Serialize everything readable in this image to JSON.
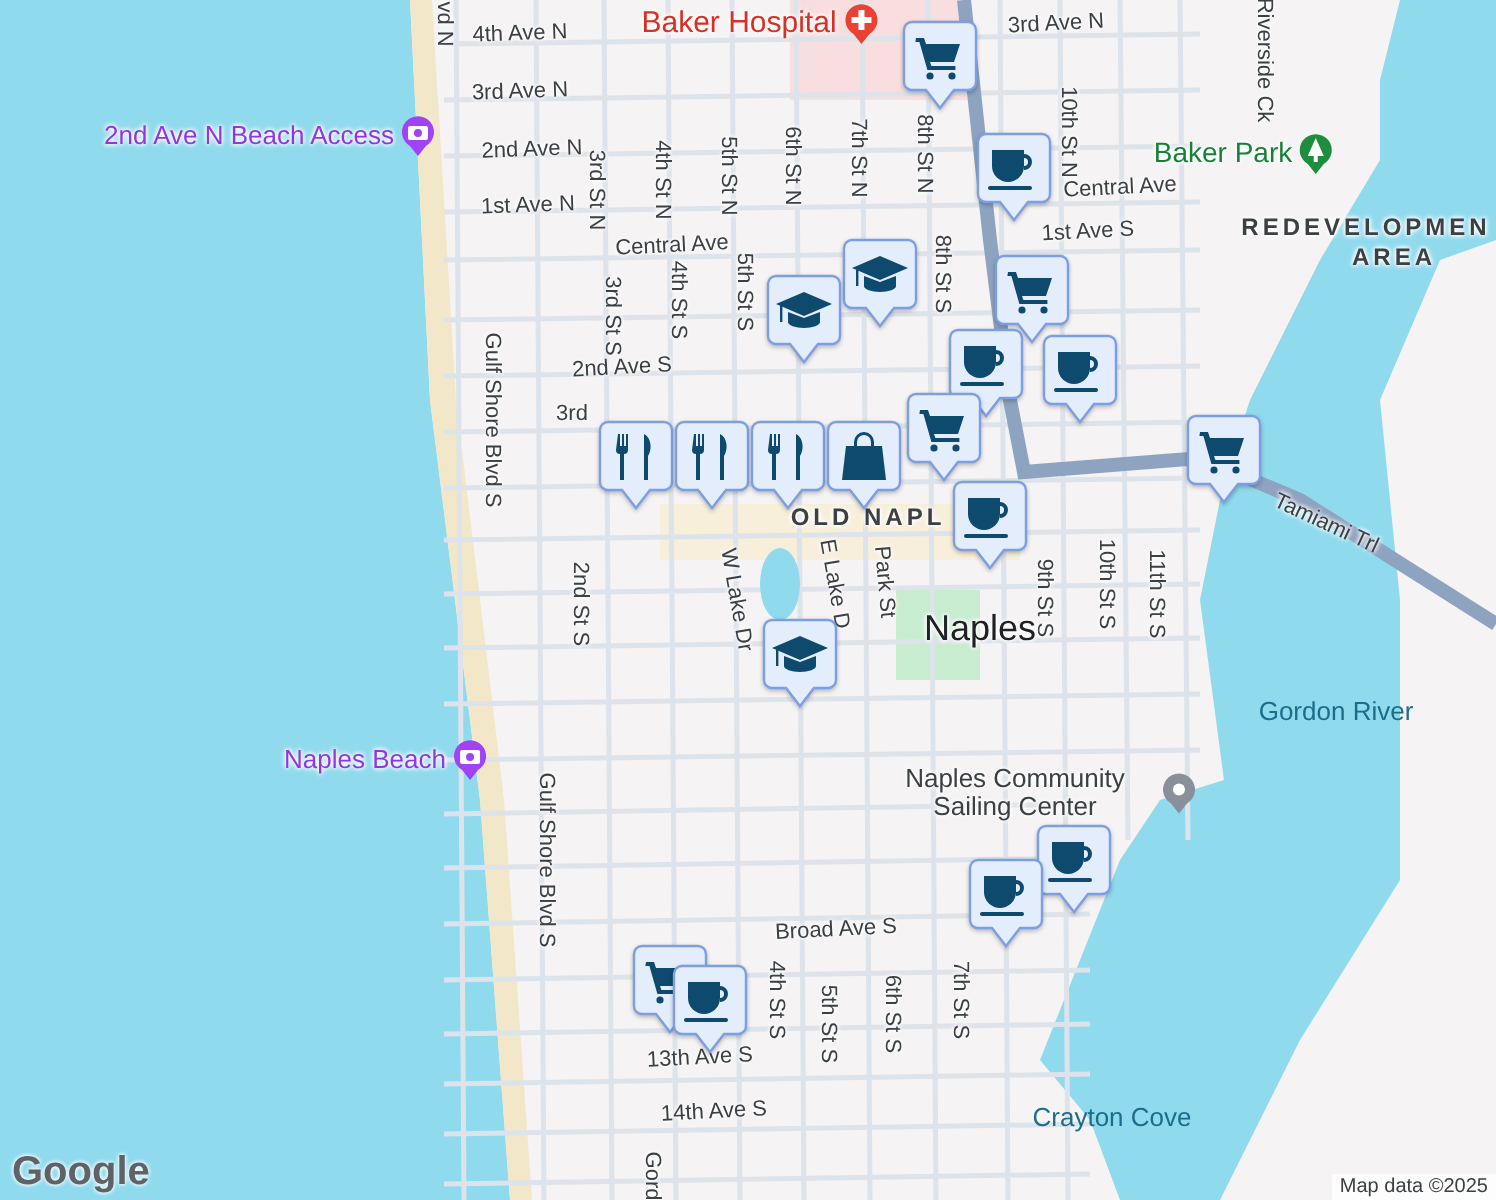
{
  "map": {
    "labels": [
      {
        "text": "vd N",
        "kind": "street"
      },
      {
        "text": "4th Ave N",
        "kind": "street"
      },
      {
        "text": "3rd Ave N",
        "kind": "street"
      },
      {
        "text": "2nd Ave N",
        "kind": "street"
      },
      {
        "text": "1st Ave N",
        "kind": "street"
      },
      {
        "text": "3rd St N",
        "kind": "street"
      },
      {
        "text": "4th St N",
        "kind": "street"
      },
      {
        "text": "5th St N",
        "kind": "street"
      },
      {
        "text": "6th St N",
        "kind": "street"
      },
      {
        "text": "7th St N",
        "kind": "street"
      },
      {
        "text": "8th St N",
        "kind": "street"
      },
      {
        "text": "10th St N",
        "kind": "street"
      },
      {
        "text": "3rd Ave N",
        "kind": "street"
      },
      {
        "text": "Central Ave",
        "kind": "street"
      },
      {
        "text": "Central Ave",
        "kind": "street"
      },
      {
        "text": "1st Ave S",
        "kind": "street"
      },
      {
        "text": "3rd St S",
        "kind": "street"
      },
      {
        "text": "4th St S",
        "kind": "street"
      },
      {
        "text": "5th St S",
        "kind": "street"
      },
      {
        "text": "8th St S",
        "kind": "street"
      },
      {
        "text": "2nd Ave S",
        "kind": "street"
      },
      {
        "text": "Riverside Ck",
        "kind": "street"
      },
      {
        "text": "Gulf Shore Blvd S",
        "kind": "street"
      },
      {
        "text": "3rd",
        "kind": "street"
      },
      {
        "text": "2nd St S",
        "kind": "street"
      },
      {
        "text": "W Lake Dr",
        "kind": "street"
      },
      {
        "text": "E Lake D",
        "kind": "street"
      },
      {
        "text": "Park St",
        "kind": "street"
      },
      {
        "text": "9th St S",
        "kind": "street"
      },
      {
        "text": "10th St S",
        "kind": "street"
      },
      {
        "text": "11th St S",
        "kind": "street"
      },
      {
        "text": "Tamiami Trl",
        "kind": "street"
      },
      {
        "text": "Gulf Shore Blvd S",
        "kind": "street"
      },
      {
        "text": "Broad Ave S",
        "kind": "street"
      },
      {
        "text": "4th St S",
        "kind": "street"
      },
      {
        "text": "5th St S",
        "kind": "street"
      },
      {
        "text": "6th St S",
        "kind": "street"
      },
      {
        "text": "7th St S",
        "kind": "street"
      },
      {
        "text": "13th Ave S",
        "kind": "street"
      },
      {
        "text": "14th Ave S",
        "kind": "street"
      },
      {
        "text": "Gord",
        "kind": "street"
      },
      {
        "text": "Baker Hospital",
        "kind": "hospital"
      },
      {
        "text": "2nd Ave N Beach Access",
        "kind": "beach"
      },
      {
        "text": "Naples Beach",
        "kind": "beach"
      },
      {
        "text": "Baker Park",
        "kind": "park"
      },
      {
        "text": "REDEVELOPMEN",
        "kind": "district"
      },
      {
        "text": "AREA",
        "kind": "district"
      },
      {
        "text": "OLD NAPL",
        "kind": "district"
      },
      {
        "text": "Naples",
        "kind": "city"
      },
      {
        "text": "Gordon River",
        "kind": "water"
      },
      {
        "text": "Naples Community Sailing Center",
        "kind": "marina"
      },
      {
        "text": "Crayton Cove",
        "kind": "water"
      }
    ],
    "markers": [
      {
        "kind": "cart"
      },
      {
        "kind": "cup"
      },
      {
        "kind": "cap"
      },
      {
        "kind": "cap"
      },
      {
        "kind": "cart"
      },
      {
        "kind": "cup"
      },
      {
        "kind": "cup"
      },
      {
        "kind": "fork"
      },
      {
        "kind": "fork"
      },
      {
        "kind": "fork"
      },
      {
        "kind": "bag"
      },
      {
        "kind": "cart"
      },
      {
        "kind": "cup"
      },
      {
        "kind": "cart"
      },
      {
        "kind": "cap"
      },
      {
        "kind": "cup"
      },
      {
        "kind": "cup"
      },
      {
        "kind": "cart"
      },
      {
        "kind": "cup"
      }
    ]
  },
  "logo": "Google",
  "attribution": "Map data ©2025"
}
